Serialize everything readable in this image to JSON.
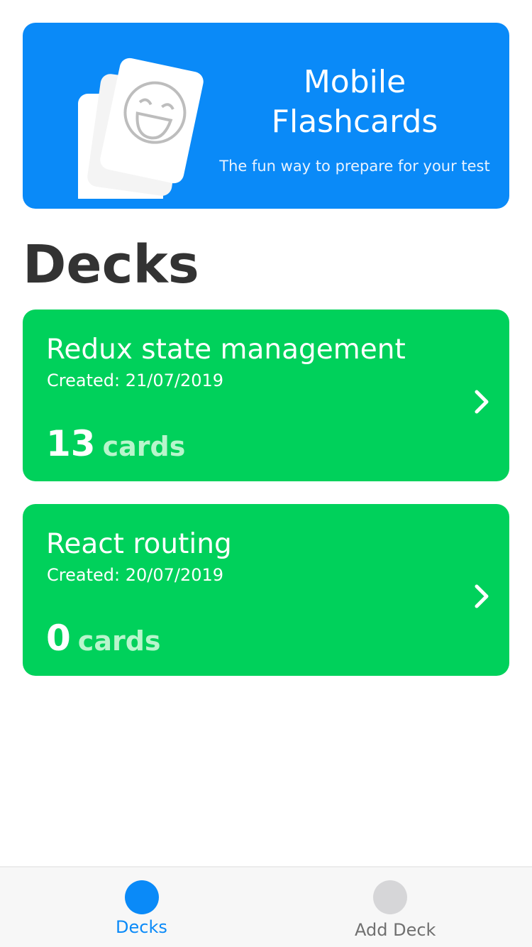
{
  "hero": {
    "title_line1": "Mobile",
    "title_line2": "Flashcards",
    "subtitle": "The fun way to prepare for your test",
    "illustration_icon": "flashcards-smiley-icon",
    "background": "#0a8af8"
  },
  "section_title": "Decks",
  "decks": [
    {
      "title": "Redux state management",
      "created": "Created: 21/07/2019",
      "count": "13",
      "unit": "cards"
    },
    {
      "title": "React routing",
      "created": "Created: 20/07/2019",
      "count": "0",
      "unit": "cards"
    }
  ],
  "colors": {
    "deck_background": "#00d15b",
    "active_tab": "#0a8af8",
    "inactive_tab": "#d6d6d8"
  },
  "tabs": [
    {
      "label": "Decks",
      "active": true,
      "icon": "decks-tab-icon"
    },
    {
      "label": "Add Deck",
      "active": false,
      "icon": "add-deck-tab-icon"
    }
  ]
}
